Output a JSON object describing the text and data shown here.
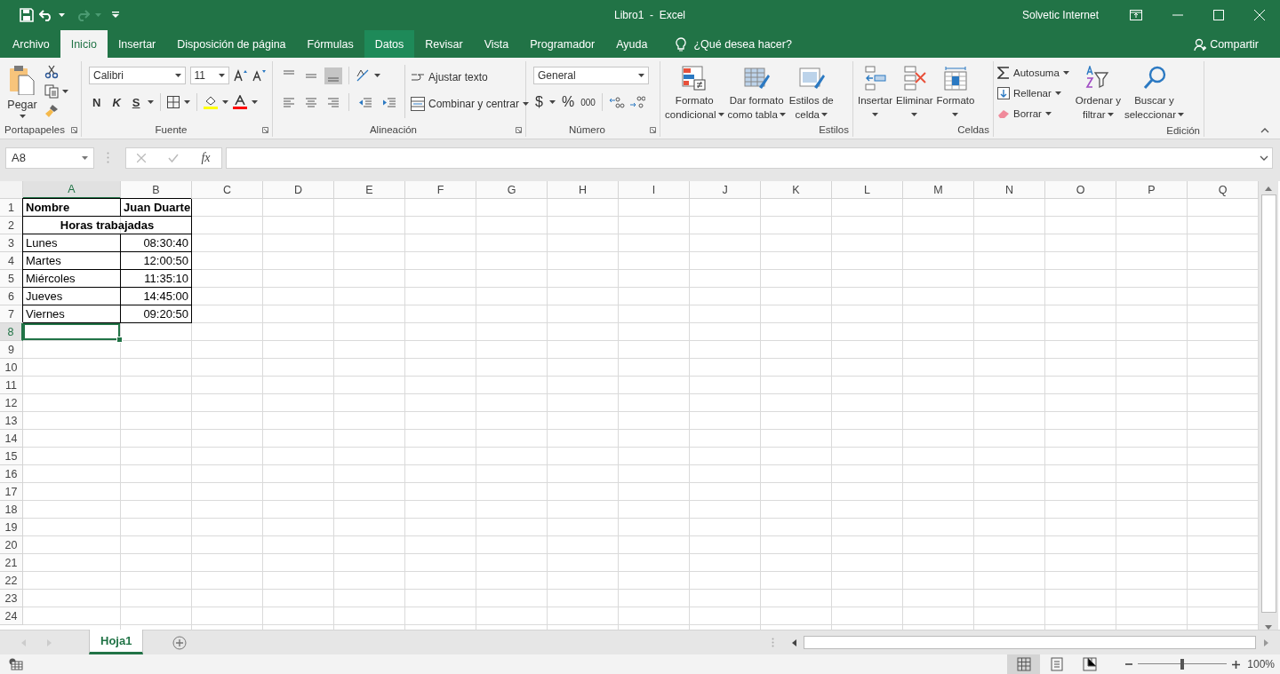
{
  "window": {
    "title": "Libro1  -  Excel",
    "user": "Solvetic Internet"
  },
  "tabs": [
    {
      "label": "Archivo",
      "selected": false,
      "hovered": false
    },
    {
      "label": "Inicio",
      "selected": true,
      "hovered": false
    },
    {
      "label": "Insertar",
      "selected": false,
      "hovered": false
    },
    {
      "label": "Disposición de página",
      "selected": false,
      "hovered": false
    },
    {
      "label": "Fórmulas",
      "selected": false,
      "hovered": false
    },
    {
      "label": "Datos",
      "selected": false,
      "hovered": true
    },
    {
      "label": "Revisar",
      "selected": false,
      "hovered": false
    },
    {
      "label": "Vista",
      "selected": false,
      "hovered": false
    },
    {
      "label": "Programador",
      "selected": false,
      "hovered": false
    },
    {
      "label": "Ayuda",
      "selected": false,
      "hovered": false
    }
  ],
  "tell_me": "¿Qué desea hacer?",
  "share": "Compartir",
  "clipboard": {
    "paste": "Pegar",
    "label": "Portapapeles"
  },
  "font": {
    "name": "Calibri",
    "size": "11",
    "bold": "N",
    "italic": "K",
    "underline": "S",
    "label": "Fuente"
  },
  "alignment": {
    "vertical": [
      {
        "selected": false
      },
      {
        "selected": false
      },
      {
        "selected": true
      }
    ],
    "wrap": "Ajustar texto",
    "merge": "Combinar y centrar",
    "label": "Alineación"
  },
  "number": {
    "format": "General",
    "currency": "$",
    "percent": "%",
    "thousands": "000",
    "label": "Número"
  },
  "styles": {
    "buttons": [
      {
        "lines": [
          "Formato",
          "condicional"
        ]
      },
      {
        "lines": [
          "Dar formato",
          "como tabla"
        ]
      },
      {
        "lines": [
          "Estilos de",
          "celda"
        ]
      }
    ],
    "label": "Estilos"
  },
  "cells": {
    "buttons": [
      "Insertar",
      "Eliminar",
      "Formato"
    ],
    "label": "Celdas"
  },
  "editing": {
    "autosum": "Autosuma",
    "fill": "Rellenar",
    "clear": "Borrar",
    "sort": [
      "Ordenar y",
      "filtrar"
    ],
    "find": [
      "Buscar y",
      "seleccionar"
    ],
    "label": "Edición"
  },
  "formula_bar": {
    "name_box": "A8",
    "fx": "fx"
  },
  "sheet": {
    "columns": [
      {
        "label": "A",
        "selected": true
      },
      {
        "label": "B",
        "selected": false
      },
      {
        "label": "C",
        "selected": false
      },
      {
        "label": "D",
        "selected": false
      },
      {
        "label": "E",
        "selected": false
      },
      {
        "label": "F",
        "selected": false
      },
      {
        "label": "G",
        "selected": false
      },
      {
        "label": "H",
        "selected": false
      },
      {
        "label": "I",
        "selected": false
      },
      {
        "label": "J",
        "selected": false
      },
      {
        "label": "K",
        "selected": false
      },
      {
        "label": "L",
        "selected": false
      },
      {
        "label": "M",
        "selected": false
      },
      {
        "label": "N",
        "selected": false
      },
      {
        "label": "O",
        "selected": false
      },
      {
        "label": "P",
        "selected": false
      },
      {
        "label": "Q",
        "selected": false
      }
    ],
    "rows": [
      {
        "label": "1",
        "selected": false,
        "cells": [
          {
            "kind": "text",
            "text": "Nombre",
            "bold": true,
            "bordered": true
          },
          {
            "kind": "text",
            "text": "Juan Duarte",
            "bold": true,
            "bordered": true
          }
        ]
      },
      {
        "label": "2",
        "selected": false,
        "cells": [
          {
            "kind": "merged",
            "text": "Horas trabajadas",
            "bold": true,
            "bordered": true
          }
        ]
      },
      {
        "label": "3",
        "selected": false,
        "cells": [
          {
            "kind": "text",
            "text": "Lunes",
            "bold": false,
            "bordered": true
          },
          {
            "kind": "time",
            "text": "08:30:40",
            "bold": false,
            "bordered": true
          }
        ]
      },
      {
        "label": "4",
        "selected": false,
        "cells": [
          {
            "kind": "text",
            "text": "Martes",
            "bold": false,
            "bordered": true
          },
          {
            "kind": "time",
            "text": "12:00:50",
            "bold": false,
            "bordered": true
          }
        ]
      },
      {
        "label": "5",
        "selected": false,
        "cells": [
          {
            "kind": "text",
            "text": "Miércoles",
            "bold": false,
            "bordered": true
          },
          {
            "kind": "time",
            "text": "11:35:10",
            "bold": false,
            "bordered": true
          }
        ]
      },
      {
        "label": "6",
        "selected": false,
        "cells": [
          {
            "kind": "text",
            "text": "Jueves",
            "bold": false,
            "bordered": true
          },
          {
            "kind": "time",
            "text": "14:45:00",
            "bold": false,
            "bordered": true
          }
        ]
      },
      {
        "label": "7",
        "selected": false,
        "cells": [
          {
            "kind": "text",
            "text": "Viernes",
            "bold": false,
            "bordered": true
          },
          {
            "kind": "time",
            "text": "09:20:50",
            "bold": false,
            "bordered": true
          }
        ]
      },
      {
        "label": "8",
        "selected": true,
        "cells": [
          {
            "selected": true
          }
        ]
      },
      {
        "label": "9",
        "selected": false
      },
      {
        "label": "10",
        "selected": false
      },
      {
        "label": "11",
        "selected": false
      },
      {
        "label": "12",
        "selected": false
      },
      {
        "label": "13",
        "selected": false
      },
      {
        "label": "14",
        "selected": false
      },
      {
        "label": "15",
        "selected": false
      },
      {
        "label": "16",
        "selected": false
      },
      {
        "label": "17",
        "selected": false
      },
      {
        "label": "18",
        "selected": false
      },
      {
        "label": "19",
        "selected": false
      },
      {
        "label": "20",
        "selected": false
      },
      {
        "label": "21",
        "selected": false
      },
      {
        "label": "22",
        "selected": false
      },
      {
        "label": "23",
        "selected": false
      },
      {
        "label": "24",
        "selected": false
      }
    ]
  },
  "sheet_tabs": [
    {
      "label": "Hoja1",
      "selected": true
    }
  ],
  "status_bar": {
    "views": [
      {
        "selected": true
      },
      {
        "selected": false
      },
      {
        "selected": false
      }
    ],
    "zoom_slider": {
      "level": 0.5
    },
    "zoom": "100%"
  }
}
